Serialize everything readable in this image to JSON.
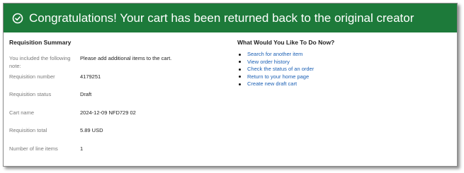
{
  "banner": {
    "icon": "check-circle-icon",
    "message": "Congratulations! Your cart has been returned back to the original creator",
    "background": "#1d7a3a"
  },
  "summary": {
    "title": "Requisition Summary",
    "rows": [
      {
        "label": "You included the following note:",
        "value": "Please add additional items to the cart."
      },
      {
        "label": "Requisition number",
        "value": "4179251"
      },
      {
        "label": "Requisition status",
        "value": "Draft"
      },
      {
        "label": "Cart name",
        "value": "2024-12-09 NFD729 02"
      },
      {
        "label": "Requisition total",
        "value": "5.89 USD"
      },
      {
        "label": "Number of line items",
        "value": "1"
      }
    ]
  },
  "actions": {
    "title": "What Would You Like To Do Now?",
    "links": [
      "Search for another item",
      "View order history",
      "Check the status of an order",
      "Return to your home page",
      "Create new draft cart"
    ],
    "link_color": "#1a5fb4"
  }
}
